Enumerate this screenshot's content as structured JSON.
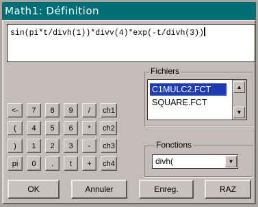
{
  "window": {
    "title": "Math1: Définition"
  },
  "formula": {
    "value": "sin(pi*t/divh(1))*divv(4)*exp(-t/divh(3))"
  },
  "keypad": {
    "keys": [
      "<-",
      "7",
      "8",
      "9",
      "/",
      "ch1",
      "(",
      "4",
      "5",
      "6",
      "*",
      "ch2",
      ")",
      "1",
      "2",
      "3",
      "-",
      "ch3",
      "pi",
      "0",
      ".",
      "t",
      "+",
      "ch4"
    ]
  },
  "files": {
    "title": "Fichiers",
    "items": [
      "C1MULC2.FCT",
      "SQUARE.FCT"
    ],
    "selected_index": 0
  },
  "functions": {
    "title": "Fonctions",
    "value": "divh("
  },
  "buttons": {
    "ok": "OK",
    "cancel": "Annuler",
    "save": "Enreg.",
    "reset": "RAZ"
  },
  "colors": {
    "titlebar": "#006f76",
    "window": "#c4bcb8",
    "selection": "#1e3bb3"
  }
}
